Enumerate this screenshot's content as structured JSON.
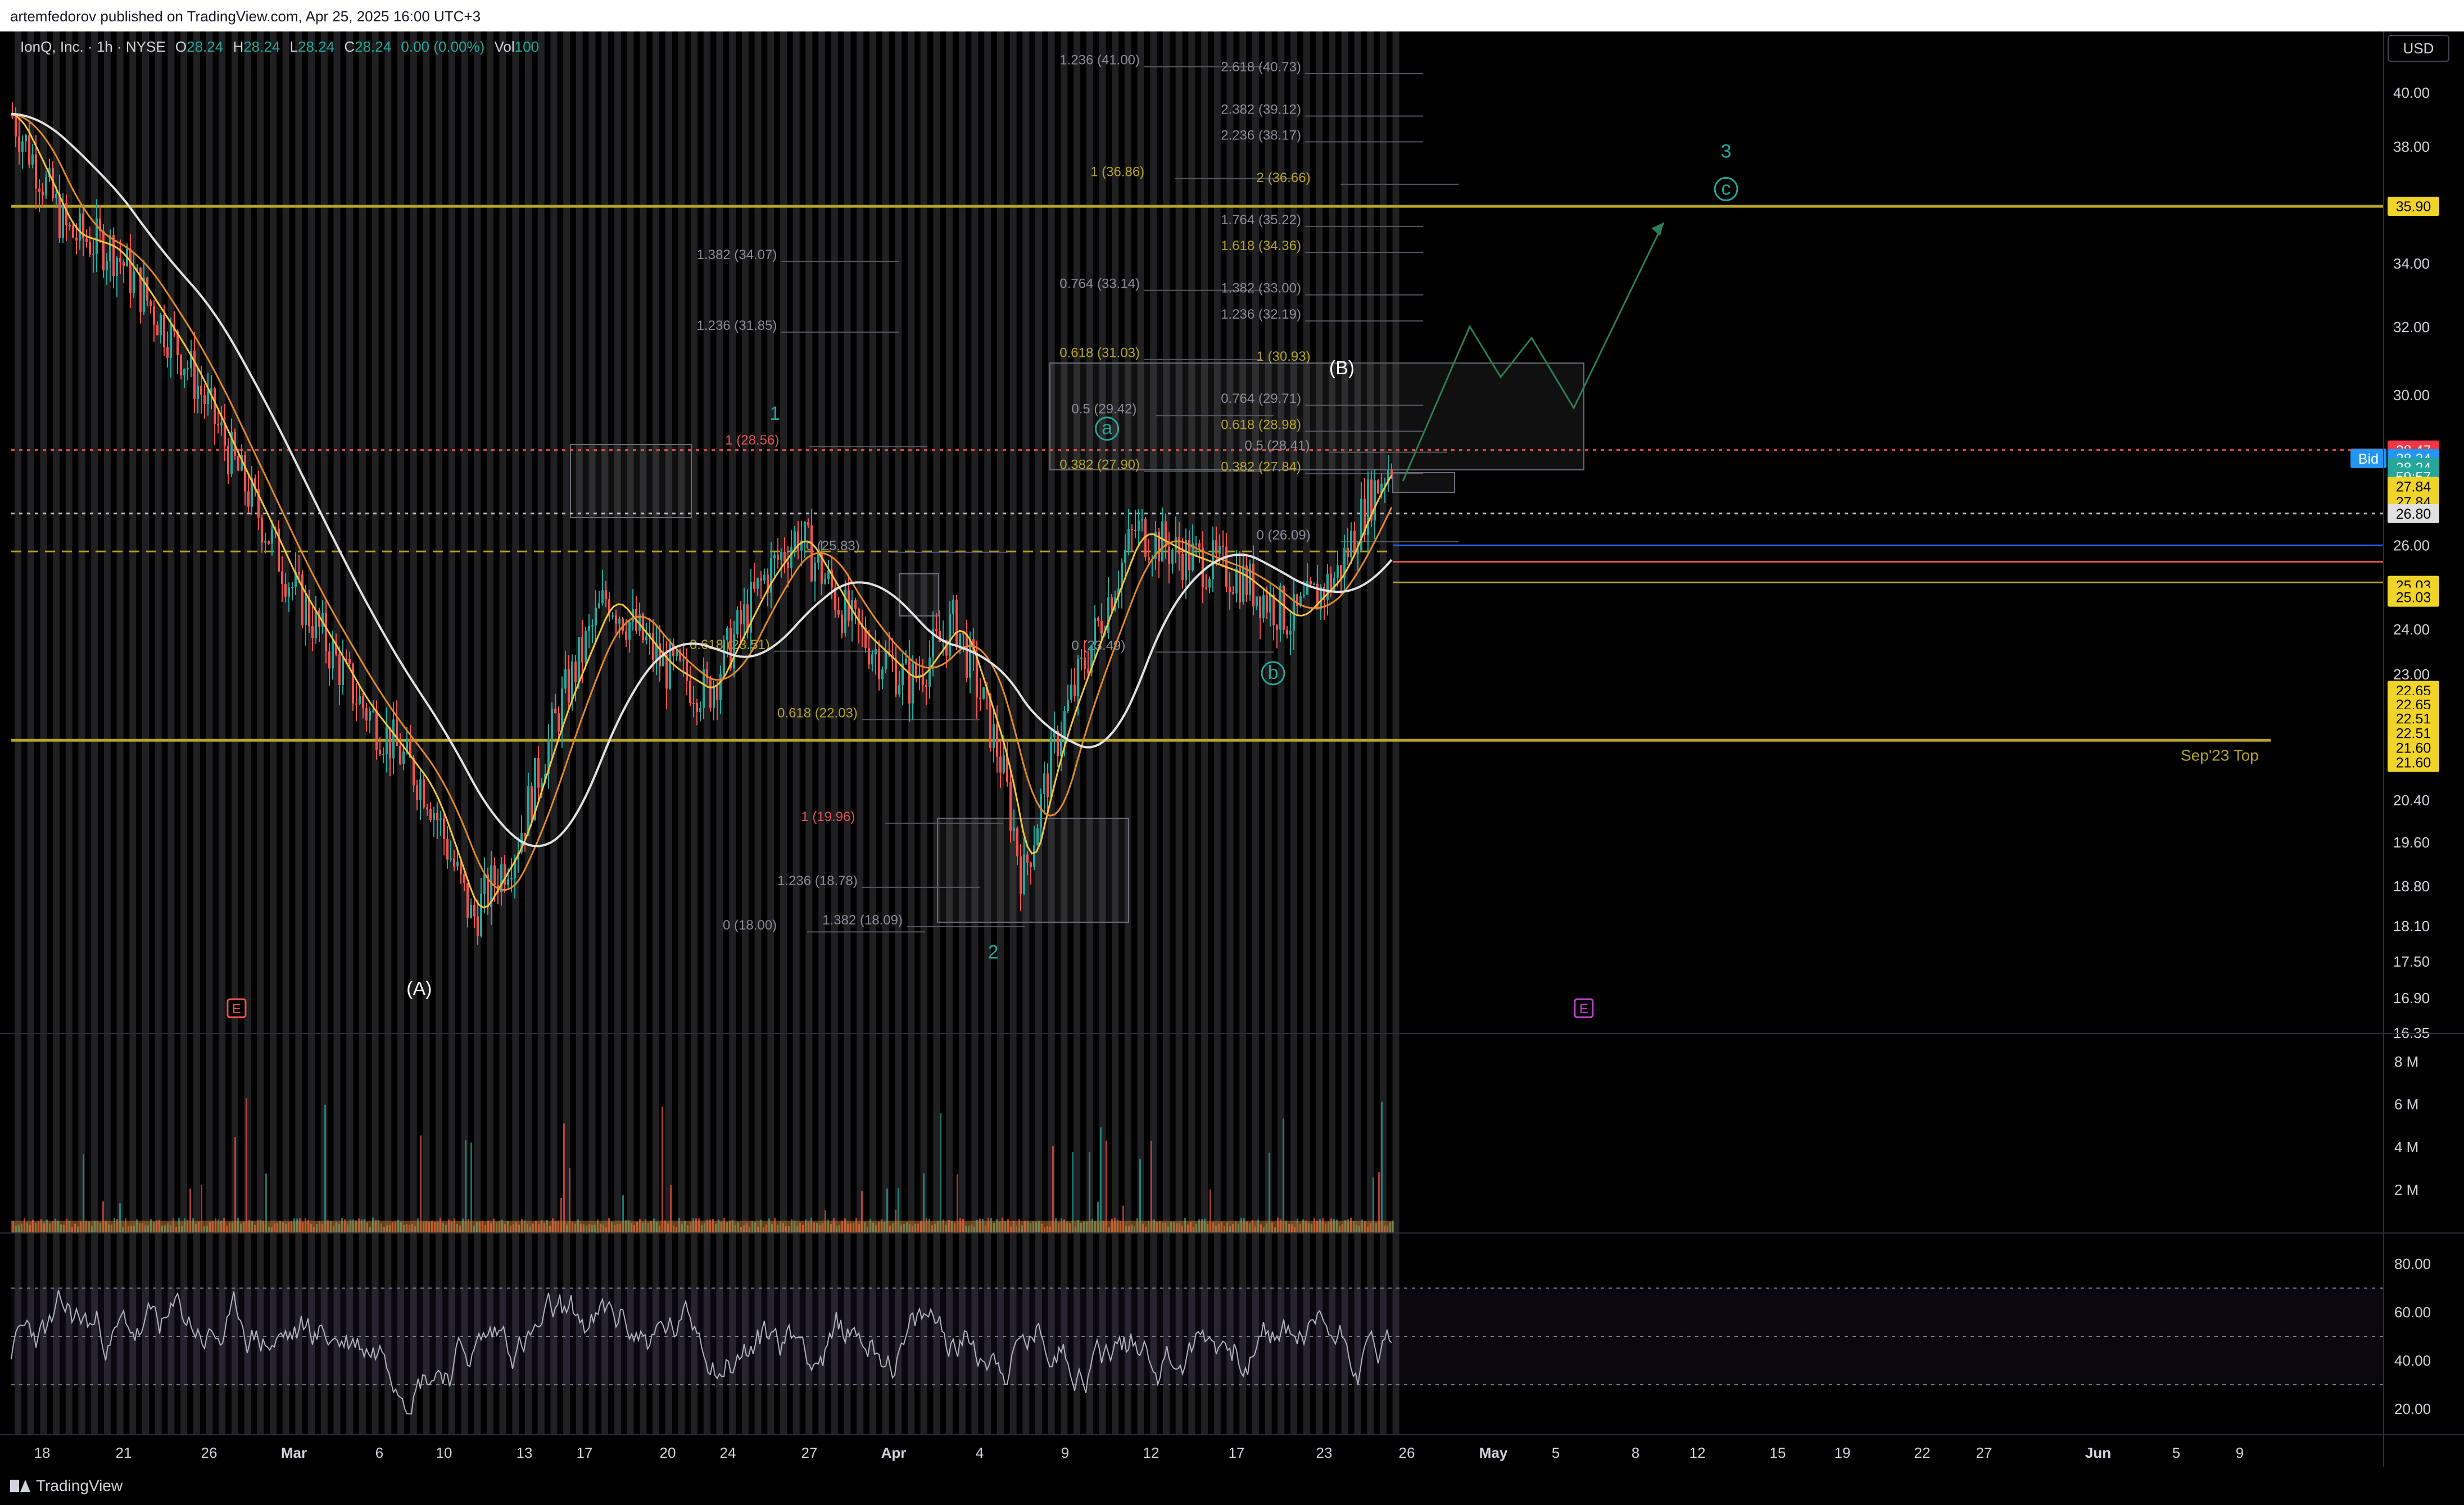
{
  "header": {
    "published": "artemfedorov published on TradingView.com, Apr 25, 2025 16:00 UTC+3"
  },
  "legend": {
    "symbol": "IonQ, Inc. · 1h · NYSE",
    "o_label": "O",
    "o": "28.24",
    "h_label": "H",
    "h": "28.24",
    "l_label": "L",
    "l": "28.24",
    "c_label": "C",
    "c": "28.24",
    "change": "0.00 (0.00%)",
    "vol_label": "Vol",
    "vol": "100"
  },
  "currency": "USD",
  "brand": "TradingView",
  "colors": {
    "up": "#26a69a",
    "down": "#ef5350",
    "ma_fast": "#f5c542",
    "ma_mid": "#e08a2e",
    "ma_slow": "#e0e0e0",
    "level_line": "#b5a32a",
    "fib_text": "#8a8d99",
    "wave_green": "#26a69a",
    "wave_white": "#ffffff",
    "projection": "#2e7d57",
    "earnings": "#ef5350",
    "earnings2": "#c040d0",
    "rsi": "#b2b5be",
    "rsi_band": "#7e57c2"
  },
  "chart_data": {
    "type": "candlestick",
    "price_axis": {
      "ticks": [
        "40.00",
        "38.00",
        "36.00",
        "34.00",
        "32.00",
        "30.00",
        "28.00",
        "27.00",
        "26.00",
        "24.00",
        "23.00",
        "21.40",
        "20.40",
        "19.60",
        "18.80",
        "18.10",
        "17.50",
        "16.90",
        "16.35"
      ],
      "ylim": [
        16.35,
        41.5
      ],
      "log_scale": true
    },
    "time_axis": {
      "labels": [
        "18",
        "21",
        "26",
        "Mar",
        "6",
        "10",
        "13",
        "17",
        "20",
        "24",
        "27",
        "Apr",
        "4",
        "9",
        "12",
        "17",
        "23",
        "26",
        "May",
        "5",
        "8",
        "12",
        "15",
        "19",
        "22",
        "27",
        "Jun",
        "5",
        "9"
      ]
    },
    "price_badges": [
      {
        "text": "35.90",
        "style": "yellow",
        "price": 35.9
      },
      {
        "text": "28.47",
        "style": "red",
        "price": 28.47
      },
      {
        "text": "Ask",
        "style": "red-label",
        "price": 28.25
      },
      {
        "text": "28.25",
        "style": "red",
        "price": 28.25
      },
      {
        "text": "Bid",
        "style": "blue-label",
        "price": 28.24
      },
      {
        "text": "28.24",
        "style": "blue",
        "price": 28.24
      },
      {
        "text": "28.24",
        "style": "teal",
        "price": 28.0
      },
      {
        "text": "59:57",
        "style": "teal",
        "price": 27.75
      },
      {
        "text": "27.84",
        "style": "yellow",
        "price": 27.5
      },
      {
        "text": "27.84",
        "style": "yellow",
        "price": 27.1
      },
      {
        "text": "26.80",
        "style": "white",
        "price": 26.8
      },
      {
        "text": "25.03",
        "style": "yellow",
        "price": 25.03
      },
      {
        "text": "25.03",
        "style": "yellow",
        "price": 24.75
      },
      {
        "text": "22.65",
        "style": "yellow",
        "price": 22.65
      },
      {
        "text": "22.65",
        "style": "yellow",
        "price": 22.35
      },
      {
        "text": "22.51",
        "style": "yellow",
        "price": 22.05
      },
      {
        "text": "22.51",
        "style": "yellow",
        "price": 21.75
      },
      {
        "text": "21.60",
        "style": "yellow",
        "price": 21.45
      },
      {
        "text": "21.60",
        "style": "yellow",
        "price": 21.15
      }
    ],
    "horizontal_levels": [
      {
        "price": 35.9,
        "style": "solid-yellow"
      },
      {
        "price": 21.6,
        "style": "solid-yellow"
      },
      {
        "price": 28.47,
        "style": "dotted-red"
      },
      {
        "price": 26.8,
        "style": "dotted-white"
      },
      {
        "price": 25.85,
        "style": "dashed-yellow"
      }
    ],
    "level_labels": [
      {
        "text": "Sep'23 Top",
        "price": 21.3
      }
    ],
    "fib_labels": [
      {
        "text": "1.236 (41.00)",
        "x": 0.442,
        "price": 41.0
      },
      {
        "text": "2.618 (40.73)",
        "x": 0.51,
        "price": 40.73
      },
      {
        "text": "2.382 (39.12)",
        "x": 0.51,
        "price": 39.12
      },
      {
        "text": "2.236 (38.17)",
        "x": 0.51,
        "price": 38.17
      },
      {
        "text": "1 (36.86)",
        "x": 0.455,
        "price": 36.86,
        "gold": true
      },
      {
        "text": "2 (36.66)",
        "x": 0.525,
        "price": 36.66,
        "gold": true
      },
      {
        "text": "1.764 (35.22)",
        "x": 0.51,
        "price": 35.22
      },
      {
        "text": "1.618 (34.36)",
        "x": 0.51,
        "price": 34.36,
        "gold": true
      },
      {
        "text": "1.382 (34.07)",
        "x": 0.289,
        "price": 34.07
      },
      {
        "text": "0.764 (33.14)",
        "x": 0.442,
        "price": 33.14
      },
      {
        "text": "1.382 (33.00)",
        "x": 0.51,
        "price": 33.0
      },
      {
        "text": "1.236 (32.19)",
        "x": 0.51,
        "price": 32.19
      },
      {
        "text": "1.236 (31.85)",
        "x": 0.289,
        "price": 31.85
      },
      {
        "text": "0.618 (31.03)",
        "x": 0.442,
        "price": 31.03,
        "gold": true
      },
      {
        "text": "1 (30.93)",
        "x": 0.525,
        "price": 30.93,
        "gold": true
      },
      {
        "text": "0.764 (29.71)",
        "x": 0.51,
        "price": 29.71
      },
      {
        "text": "0.5 (29.42)",
        "x": 0.447,
        "price": 29.42
      },
      {
        "text": "0.618 (28.98)",
        "x": 0.51,
        "price": 28.98,
        "gold": true
      },
      {
        "text": "1 (28.56)",
        "x": 0.301,
        "price": 28.56,
        "red": true
      },
      {
        "text": "0.5 (28.41)",
        "x": 0.52,
        "price": 28.41
      },
      {
        "text": "0.382 (27.90)",
        "x": 0.442,
        "price": 27.9,
        "gold": true
      },
      {
        "text": "0.382 (27.84)",
        "x": 0.51,
        "price": 27.84,
        "gold": true
      },
      {
        "text": "0 (26.09)",
        "x": 0.525,
        "price": 26.09
      },
      {
        "text": "0 (25.83)",
        "x": 0.335,
        "price": 25.83
      },
      {
        "text": "0.618 (23.51)",
        "x": 0.286,
        "price": 23.51,
        "gold": true
      },
      {
        "text": "0 (23.49)",
        "x": 0.447,
        "price": 23.49
      },
      {
        "text": "0.618 (22.03)",
        "x": 0.323,
        "price": 22.03,
        "gold": true
      },
      {
        "text": "1 (19.96)",
        "x": 0.333,
        "price": 19.96,
        "red": true
      },
      {
        "text": "1.236 (18.78)",
        "x": 0.323,
        "price": 18.78
      },
      {
        "text": "1.382 (18.09)",
        "x": 0.342,
        "price": 18.09
      },
      {
        "text": "0 (18.00)",
        "x": 0.3,
        "price": 18.0
      }
    ],
    "wave_labels": [
      {
        "text": "(A)",
        "x": 0.172,
        "price": 16.95,
        "style": "white"
      },
      {
        "text": "1",
        "x": 0.322,
        "price": 29.3,
        "style": "green"
      },
      {
        "text": "2",
        "x": 0.414,
        "price": 17.55,
        "style": "green"
      },
      {
        "text": "a",
        "x": 0.462,
        "price": 28.9,
        "style": "green-circle"
      },
      {
        "text": "b",
        "x": 0.532,
        "price": 22.9,
        "style": "green-circle"
      },
      {
        "text": "(B)",
        "x": 0.561,
        "price": 30.6,
        "style": "white"
      },
      {
        "text": "3",
        "x": 0.723,
        "price": 37.6,
        "style": "green"
      },
      {
        "text": "c",
        "x": 0.723,
        "price": 36.3,
        "style": "green-circle"
      }
    ],
    "earnings_markers": [
      {
        "text": "E",
        "x": 0.095,
        "style": "red"
      },
      {
        "text": "E",
        "x": 0.663,
        "style": "purple"
      }
    ],
    "volume_axis": {
      "ticks": [
        "8 M",
        "6 M",
        "4 M",
        "2 M"
      ],
      "ylim": [
        0,
        9
      ]
    },
    "rsi_axis": {
      "ticks": [
        "80.00",
        "60.00",
        "40.00",
        "20.00"
      ],
      "ylim": [
        10,
        90
      ],
      "band": [
        30,
        70
      ],
      "mid": 50
    }
  }
}
